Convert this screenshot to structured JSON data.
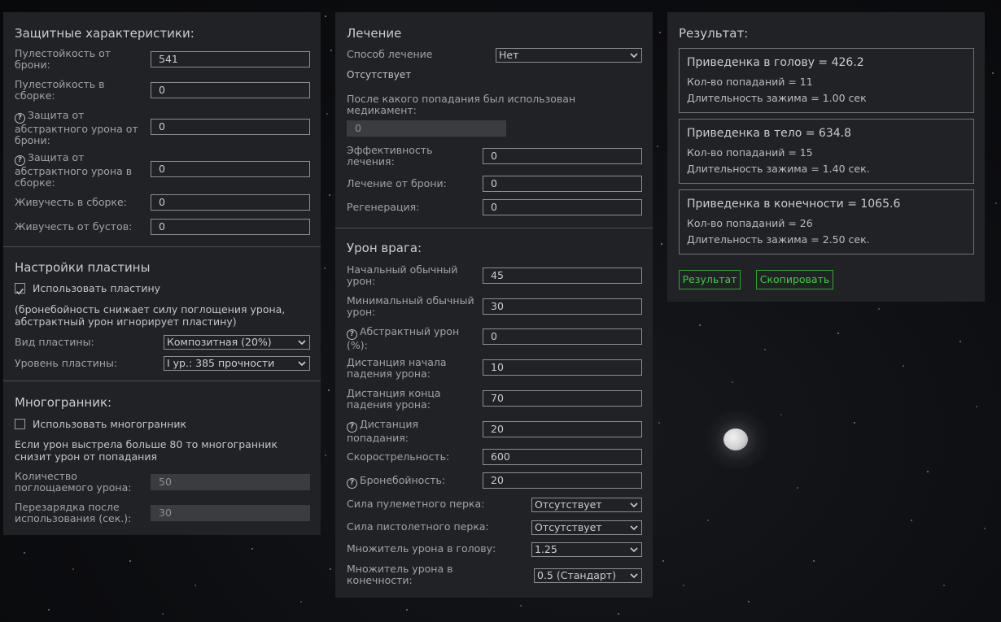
{
  "defense": {
    "title": "Защитные характеристики:",
    "armor_bullet_res_label": "Пулестойкость от брони:",
    "armor_bullet_res_value": "541",
    "build_bullet_res_label": "Пулестойкость в сборке:",
    "build_bullet_res_value": "0",
    "abstract_armor_label": "Защита от абстрактного урона от брони:",
    "abstract_armor_value": "0",
    "abstract_build_label": "Защита от абстрактного урона в сборке:",
    "abstract_build_value": "0",
    "build_vitality_label": "Живучесть в сборке:",
    "build_vitality_value": "0",
    "boost_vitality_label": "Живучесть от бустов:",
    "boost_vitality_value": "0"
  },
  "plate": {
    "title": "Настройки пластины",
    "use_plate_label": "Использовать пластину",
    "use_plate_checked": true,
    "note": "(бронебойность снижает силу поглощения урона, абстрактный урон игнорирует пластину)",
    "type_label": "Вид пластины:",
    "type_value": "Композитная (20%)",
    "level_label": "Уровень пластины:",
    "level_value": "I ур.: 385 прочности"
  },
  "polyhedron": {
    "title": "Многогранник:",
    "use_label": "Использовать многогранник",
    "use_checked": false,
    "note": "Если урон выстрела больше 80 то многогранник снизит урон от попадания",
    "absorb_label": "Количество поглощаемого урона:",
    "absorb_value": "50",
    "cooldown_label": "Перезарядка после использования (сек.):",
    "cooldown_value": "30"
  },
  "healing": {
    "title": "Лечение",
    "method_label": "Способ лечение",
    "method_value": "Нет",
    "method_status": "Отсутствует",
    "after_hit_label": "После какого попадания был использован медикамент:",
    "after_hit_value": "0",
    "efficiency_label": "Эффективность лечения:",
    "efficiency_value": "0",
    "armor_heal_label": "Лечение от брони:",
    "armor_heal_value": "0",
    "regen_label": "Регенерация:",
    "regen_value": "0"
  },
  "enemy": {
    "title": "Урон врага:",
    "initial_damage_label": "Начальный обычный урон:",
    "initial_damage_value": "45",
    "min_damage_label": "Минимальный обычный урон:",
    "min_damage_value": "30",
    "abstract_damage_label": "Абстрактный урон (%):",
    "abstract_damage_value": "0",
    "falloff_start_label": "Дистанция начала падения урона:",
    "falloff_start_value": "10",
    "falloff_end_label": "Дистанция конца падения урона:",
    "falloff_end_value": "70",
    "hit_distance_label": "Дистанция попадания:",
    "hit_distance_value": "20",
    "fire_rate_label": "Скорострельность:",
    "fire_rate_value": "600",
    "armor_pen_label": "Бронебойность:",
    "armor_pen_value": "20",
    "mg_perk_label": "Сила пулеметного перка:",
    "mg_perk_value": "Отсутствует",
    "pistol_perk_label": "Сила пистолетного перка:",
    "pistol_perk_value": "Отсутствует",
    "head_mult_label": "Множитель урона в голову:",
    "head_mult_value": "1.25",
    "limb_mult_label": "Множитель урона в конечности:",
    "limb_mult_value": "0.5 (Стандарт)"
  },
  "result": {
    "title": "Результат:",
    "items": [
      {
        "heading": "Приведенка в голову = 426.2",
        "hits": "Кол-во попаданий = 11",
        "hold": "Длительность зажима = 1.00 сек"
      },
      {
        "heading": "Приведенка в тело = 634.8",
        "hits": "Кол-во попаданий = 15",
        "hold": "Длительность зажима = 1.40 сек."
      },
      {
        "heading": "Приведенка в конечности = 1065.6",
        "hits": "Кол-во попаданий = 26",
        "hold": "Длительность зажима = 2.50 сек."
      }
    ],
    "result_button": "Результат",
    "copy_button": "Скопировать"
  }
}
